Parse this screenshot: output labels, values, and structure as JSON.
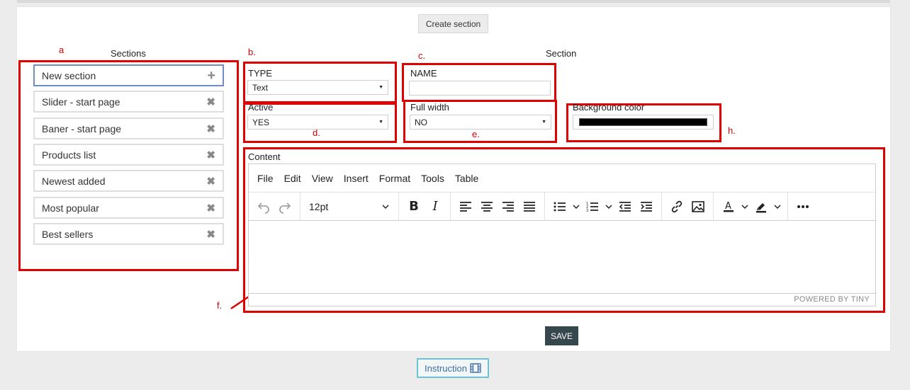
{
  "header": {
    "create_button": "Create section"
  },
  "sections_panel": {
    "title": "Sections",
    "items": [
      {
        "label": "New section",
        "icon": "plus-icon"
      },
      {
        "label": "Slider - start page",
        "icon": "close-icon"
      },
      {
        "label": "Baner - start page",
        "icon": "close-icon"
      },
      {
        "label": "Products list",
        "icon": "close-icon"
      },
      {
        "label": "Newest added",
        "icon": "close-icon"
      },
      {
        "label": "Most popular",
        "icon": "close-icon"
      },
      {
        "label": "Best sellers",
        "icon": "close-icon"
      }
    ]
  },
  "section_form": {
    "title": "Section",
    "type": {
      "label": "TYPE",
      "value": "Text"
    },
    "name": {
      "label": "NAME",
      "value": ""
    },
    "active": {
      "label": "Active",
      "value": "YES"
    },
    "full_width": {
      "label": "Full width",
      "value": "NO"
    },
    "background_color": {
      "label": "Background color",
      "value": "#000000"
    },
    "content": {
      "label": "Content"
    }
  },
  "editor": {
    "menu": [
      "File",
      "Edit",
      "View",
      "Insert",
      "Format",
      "Tools",
      "Table"
    ],
    "font_size": "12pt",
    "status": "POWERED BY TINY"
  },
  "annotations": {
    "a": "a",
    "b": "b.",
    "c": "c.",
    "d": "d.",
    "e": "e.",
    "f": "f.",
    "h": "h."
  },
  "footer": {
    "save_button": "SAVE",
    "instruction_button": "Instruction"
  },
  "colors": {
    "annotation_red": "#e00000",
    "save_bg": "#36474e",
    "active_border": "#6f8dc4"
  }
}
